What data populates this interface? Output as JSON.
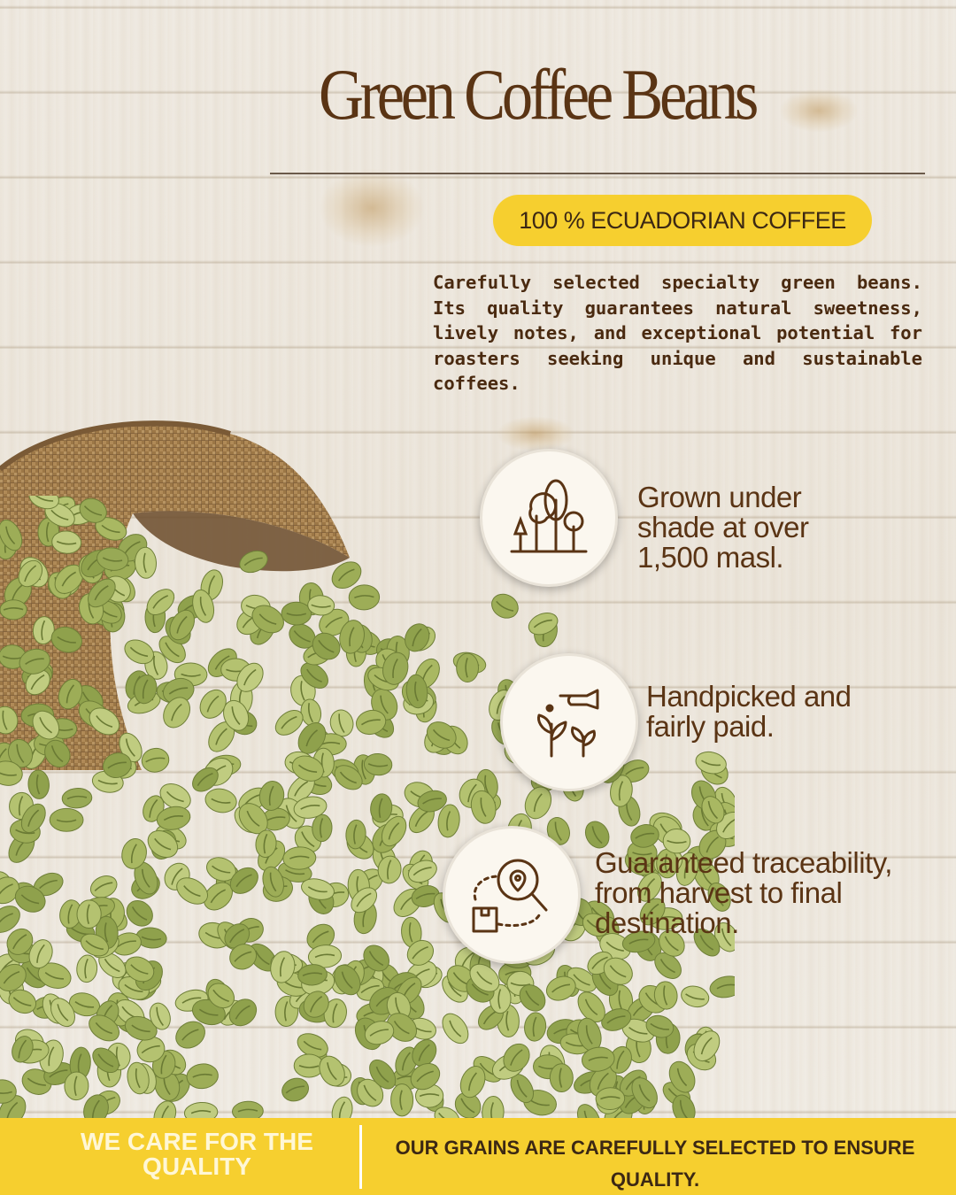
{
  "header": {
    "title": "Green Coffee Beans",
    "badge": "100 % ECUADORIAN COFFEE"
  },
  "description": "Carefully selected specialty green beans. Its quality guarantees natural sweetness, lively notes, and exceptional potential for roasters seeking unique and sustainable coffees.",
  "features": [
    {
      "icon": "trees-icon",
      "text_lines": [
        "Grown under",
        "shade at over",
        "1,500 masl."
      ]
    },
    {
      "icon": "hand-plant-icon",
      "text_lines": [
        "Handpicked and",
        "fairly paid."
      ]
    },
    {
      "icon": "location-search-icon",
      "text_lines": [
        "Guaranteed traceability,",
        "from harvest to final",
        "destination."
      ]
    }
  ],
  "footer": {
    "left_lines": [
      "WE CARE FOR THE",
      "QUALITY"
    ],
    "right_lines": [
      "OUR GRAINS ARE CAREFULLY SELECTED TO ENSURE",
      "QUALITY."
    ]
  },
  "colors": {
    "title_brown": "#5a3414",
    "accent_yellow": "#f6cf2f",
    "bean_green": "#a9b862",
    "burlap": "#a17d4e"
  }
}
